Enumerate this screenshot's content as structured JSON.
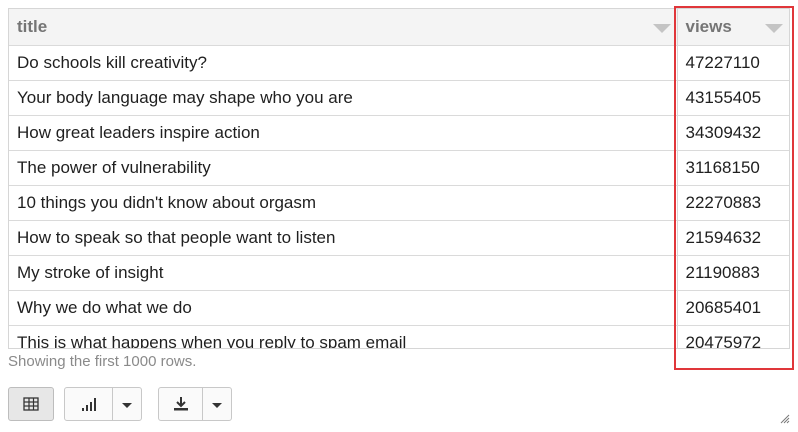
{
  "table": {
    "columns": [
      "title",
      "views"
    ],
    "rows": [
      {
        "title": "Do schools kill creativity?",
        "views": "47227110"
      },
      {
        "title": "Your body language may shape who you are",
        "views": "43155405"
      },
      {
        "title": "How great leaders inspire action",
        "views": "34309432"
      },
      {
        "title": "The power of vulnerability",
        "views": "31168150"
      },
      {
        "title": "10 things you didn't know about orgasm",
        "views": "22270883"
      },
      {
        "title": "How to speak so that people want to listen",
        "views": "21594632"
      },
      {
        "title": "My stroke of insight",
        "views": "21190883"
      },
      {
        "title": "Why we do what we do",
        "views": "20685401"
      },
      {
        "title": "This is what happens when you reply to spam email",
        "views": "20475972"
      }
    ]
  },
  "status": "Showing the first 1000 rows.",
  "toolbar": {
    "table_icon": "table-icon",
    "chart_icon": "bar-chart-icon",
    "download_icon": "download-icon",
    "dropdown_icon": "caret-down-icon"
  },
  "colors": {
    "highlight": "#e0363a",
    "header_bg": "#f4f4f4",
    "header_text": "#757575"
  }
}
